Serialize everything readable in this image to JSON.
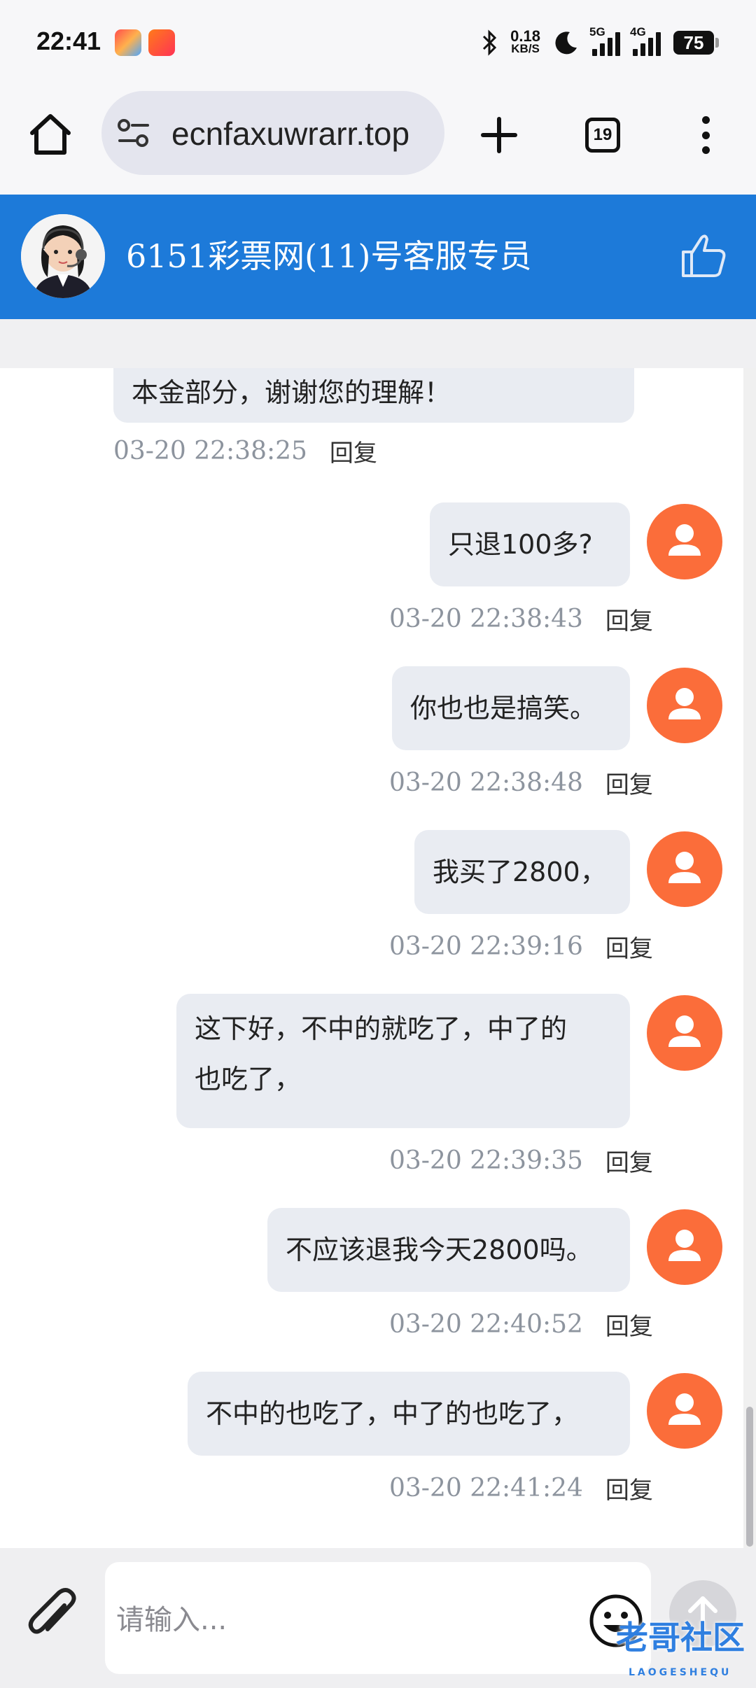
{
  "status_bar": {
    "time": "22:41",
    "net_speed_value": "0.18",
    "net_speed_unit": "KB/S",
    "signal1_label": "5G",
    "signal2_label": "4G",
    "battery": "75"
  },
  "browser": {
    "url": "ecnfaxuwrarr.top",
    "tab_count": "19"
  },
  "chat": {
    "title": "6151彩票网(11)号客服专员",
    "reply_label": "回复",
    "messages": [
      {
        "from": "agent",
        "text": "本金部分，谢谢您的理解！",
        "time": "03-20 22:38:25"
      },
      {
        "from": "user",
        "text": "只退100多?",
        "time": "03-20 22:38:43"
      },
      {
        "from": "user",
        "text": "你也也是搞笑。",
        "time": "03-20 22:38:48"
      },
      {
        "from": "user",
        "text": "我买了2800，",
        "time": "03-20 22:39:16"
      },
      {
        "from": "user",
        "text_line1": "这下好，不中的就吃了，中了的",
        "text_line2": "也吃了，",
        "time": "03-20 22:39:35"
      },
      {
        "from": "user",
        "text": "不应该退我今天2800吗。",
        "time": "03-20 22:40:52"
      },
      {
        "from": "user",
        "text": "不中的也吃了，中了的也吃了，",
        "time": "03-20 22:41:24"
      }
    ]
  },
  "input": {
    "placeholder": "请输入..."
  },
  "watermark": {
    "text": "老哥社区",
    "sub": "LAOGESHEQU"
  },
  "colors": {
    "header_blue": "#1d7ad9",
    "user_avatar": "#fb6d3a",
    "bubble_bg": "#e9ecf2"
  }
}
